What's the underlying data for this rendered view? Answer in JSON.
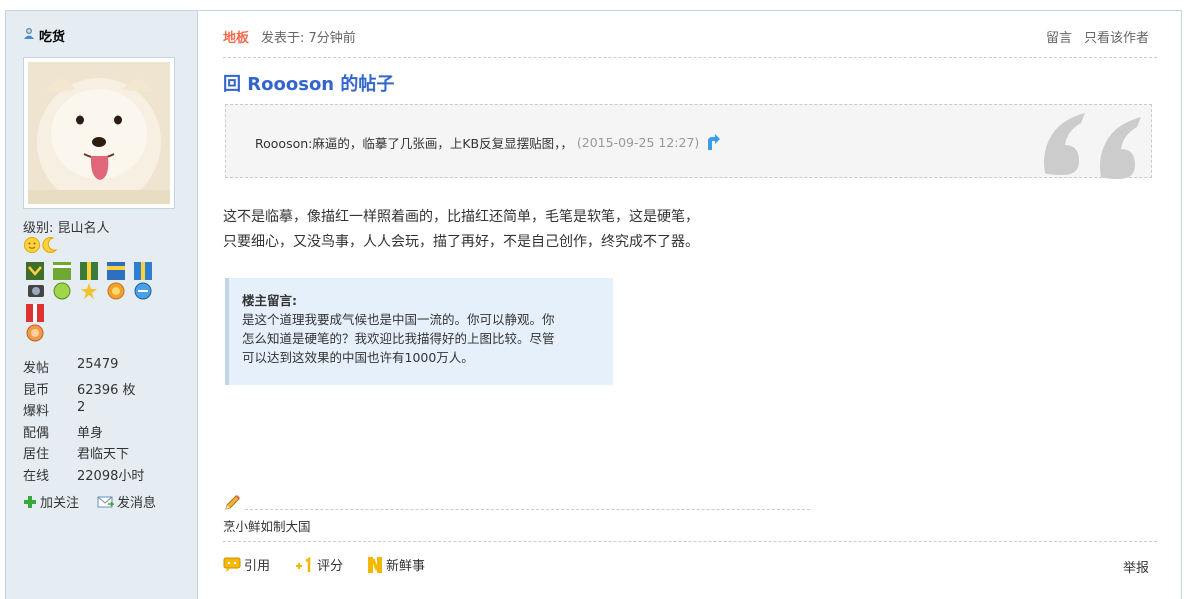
{
  "author": {
    "name": "吃货"
  },
  "profile": {
    "level_label": "级别: 昆山名人",
    "stats": [
      {
        "key": "发帖",
        "value": "25479"
      },
      {
        "key": "昆币",
        "value": "62396 枚"
      },
      {
        "key": "爆料",
        "value": "2"
      },
      {
        "key": "配偶",
        "value": "单身"
      },
      {
        "key": "居住",
        "value": "君临天下"
      },
      {
        "key": "在线",
        "value": "22098小时"
      }
    ],
    "follow_label": "加关注",
    "message_label": "发消息"
  },
  "post": {
    "floor": "地板",
    "posted_time": "发表于: 7分钟前",
    "leave_message": "留言",
    "only_author": "只看该作者",
    "title": "回 Roooson 的帖子",
    "quote": {
      "text": "Roooson:麻逼的，临摹了几张画，上KB反复显摆贴图，，",
      "time": "(2015-09-25 12:27)"
    },
    "body_line1": "这不是临摹，像描红一样照着画的，比描红还简单，毛笔是软笔，这是硬笔，",
    "body_line2": "只要细心，又没鸟事，人人会玩，描了再好，不是自己创作，终究成不了器。",
    "reply_heading": "楼主留言:",
    "reply_line1": "是这个道理我要成气候也是中国一流的。你可以静观。你",
    "reply_line2": "怎么知道是硬笔的？我欢迎比我描得好的上图比较。尽管",
    "reply_line3": "可以达到这效果的中国也许有1000万人。",
    "signature": "烹小鲜如制大国",
    "actions": {
      "quote": "引用",
      "rate": "评分",
      "news": "新鲜事",
      "report": "举报"
    }
  },
  "colors": {
    "link_blue": "#3366cc",
    "floor_orange": "#f26c4f",
    "sidebar_bg": "#e5edf2"
  }
}
